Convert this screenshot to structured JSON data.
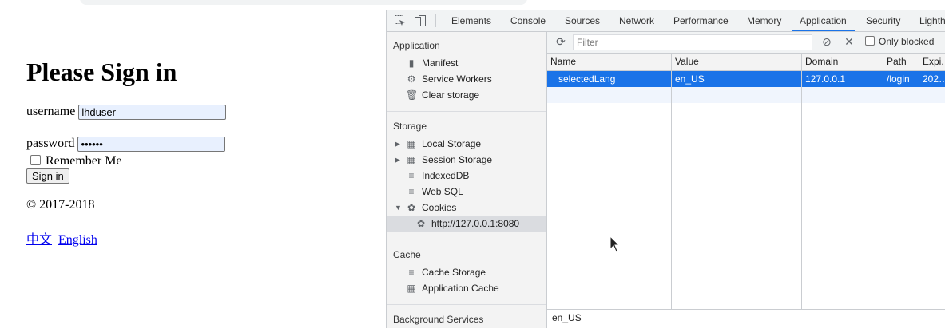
{
  "page": {
    "heading": "Please Sign in",
    "username_label": "username",
    "username_value": "lhduser",
    "password_label": "password",
    "password_value": "••••••",
    "remember_label": "Remember Me",
    "signin_button": "Sign in",
    "copyright": "© 2017-2018",
    "languages": [
      "中文",
      "English"
    ]
  },
  "devtools": {
    "tabs": [
      "Elements",
      "Console",
      "Sources",
      "Network",
      "Performance",
      "Memory",
      "Application",
      "Security",
      "Lighth"
    ],
    "active_tab": "Application",
    "sidebar": {
      "application": {
        "title": "Application",
        "items": [
          {
            "label": "Manifest",
            "icon": "document-icon"
          },
          {
            "label": "Service Workers",
            "icon": "gear-icon"
          },
          {
            "label": "Clear storage",
            "icon": "trash-icon"
          }
        ]
      },
      "storage": {
        "title": "Storage",
        "items": [
          {
            "label": "Local Storage",
            "icon": "grid-icon"
          },
          {
            "label": "Session Storage",
            "icon": "grid-icon"
          },
          {
            "label": "IndexedDB",
            "icon": "database-icon"
          },
          {
            "label": "Web SQL",
            "icon": "database-icon"
          },
          {
            "label": "Cookies",
            "icon": "cookie-icon"
          },
          {
            "label": "http://127.0.0.1:8080",
            "icon": "cookie-icon"
          }
        ]
      },
      "cache": {
        "title": "Cache",
        "items": [
          {
            "label": "Cache Storage",
            "icon": "database-icon"
          },
          {
            "label": "Application Cache",
            "icon": "grid-icon"
          }
        ]
      },
      "background": {
        "title": "Background Services"
      }
    },
    "toolbar": {
      "filter_placeholder": "Filter",
      "only_blocked": "Only blocked"
    },
    "cookies_table": {
      "columns": [
        "Name",
        "Value",
        "Domain",
        "Path",
        "Expi."
      ],
      "rows": [
        {
          "name": "selectedLang",
          "value": "en_US",
          "domain": "127.0.0.1",
          "path": "/login",
          "expires": "202…"
        }
      ]
    },
    "preview_value": "en_US",
    "accent": "#1a73e8"
  }
}
